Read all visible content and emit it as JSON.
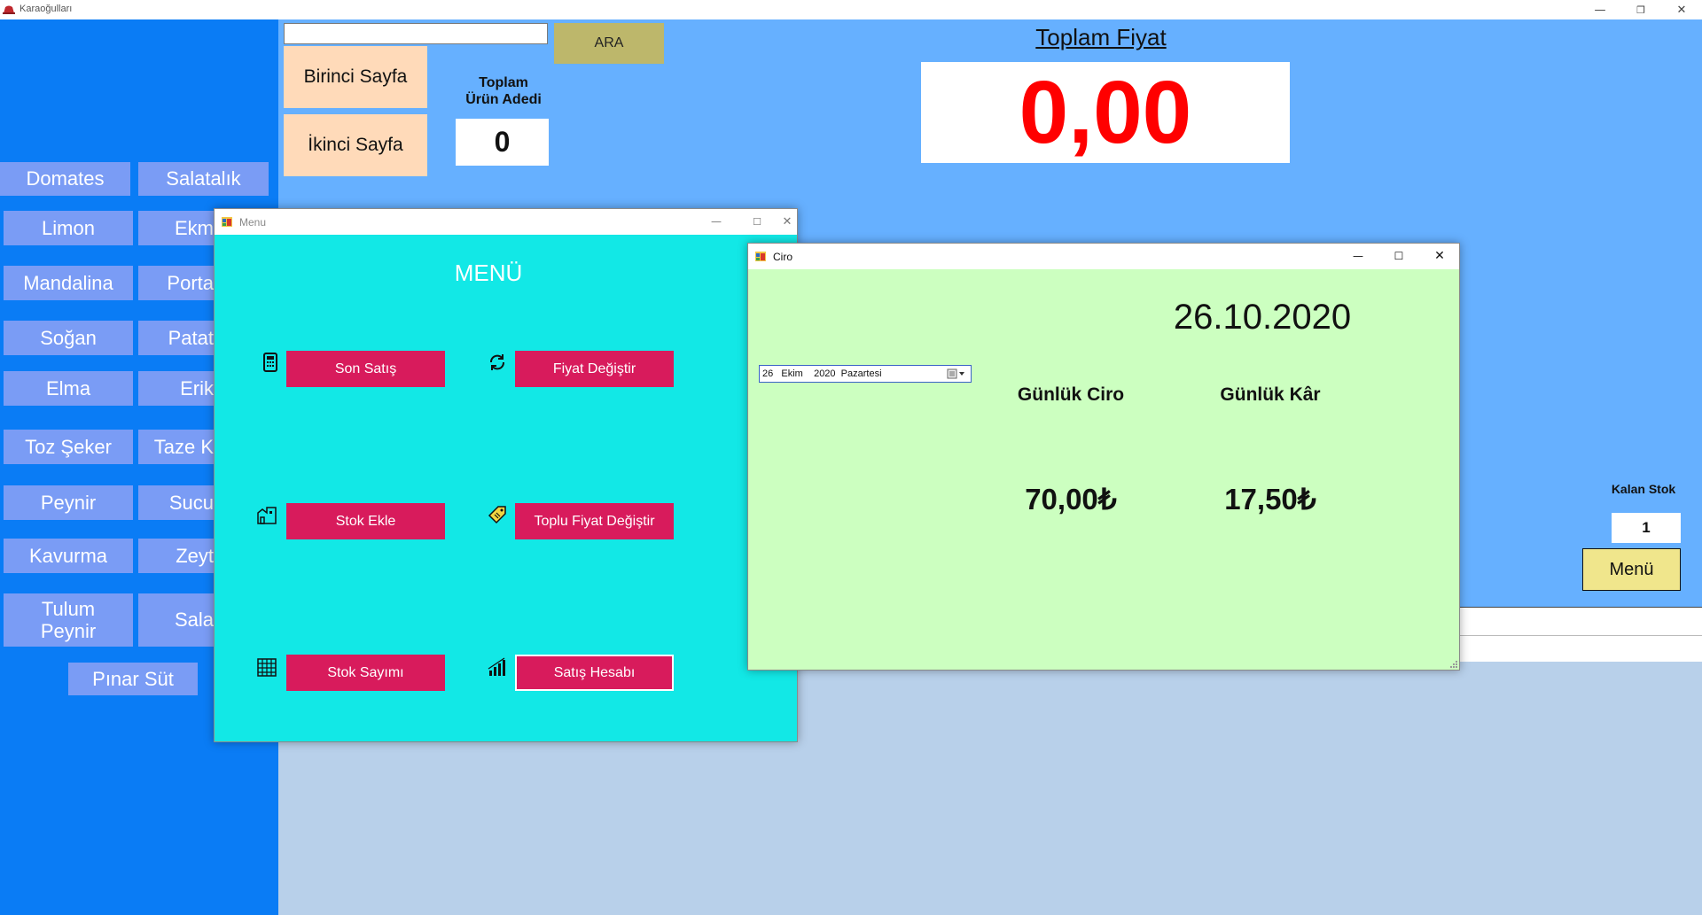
{
  "app": {
    "title": "Karaoğulları"
  },
  "window_controls": {
    "minimize": "—",
    "maximize": "❐",
    "close": "✕"
  },
  "products": [
    "Domates",
    "Salatalık",
    "Limon",
    "Ekm",
    "Mandalina",
    "Porta",
    "Soğan",
    "Patat",
    "Elma",
    "Erik",
    "Toz Şeker",
    "Taze K",
    "Peynir",
    "Sucu",
    "Kavurma",
    "Zeyt",
    "Tulum\nPeynir",
    "Sala",
    "Pınar Süt"
  ],
  "search": {
    "value": "",
    "button_label": "ARA"
  },
  "pages": {
    "first": "Birinci  Sayfa",
    "second": "İkinci Sayfa"
  },
  "total_count": {
    "label": "Toplam\nÜrün Adedi",
    "value": "0"
  },
  "total_price": {
    "title": "Toplam Fiyat",
    "value": "0,00"
  },
  "stock": {
    "label": "Kalan Stok",
    "value": "1"
  },
  "main_menu_button": "Menü",
  "menu_window": {
    "title": "Menu",
    "heading": "MENÜ",
    "buttons": {
      "son_satis": "Son Satış",
      "fiyat_degistir": "Fiyat Değiştir",
      "stok_ekle": "Stok Ekle",
      "toplu_fiyat": "Toplu Fiyat Değiştir",
      "stok_sayimi": "Stok Sayımı",
      "satis_hesabi": "Satış Hesabı"
    },
    "icons": [
      "calculator-icon",
      "refresh-icon",
      "warehouse-icon",
      "price-tag-icon",
      "building-grid-icon",
      "bar-chart-icon"
    ]
  },
  "ciro_window": {
    "title": "Ciro",
    "date": "26.10.2020",
    "date_picker": "26   Ekim    2020  Pazartesi",
    "daily_revenue_label": "Günlük Ciro",
    "daily_profit_label": "Günlük Kâr",
    "daily_revenue": "70,00₺",
    "daily_profit": "17,50₺"
  },
  "colors": {
    "left_panel": "#0a7cf5",
    "main_bg": "#66b0ff",
    "product_button": "#7a9cf5",
    "menu_bg": "#12e8e6",
    "menu_button": "#d81b5c",
    "ciro_bg": "#ccffc0",
    "price_text": "#ff0000"
  }
}
